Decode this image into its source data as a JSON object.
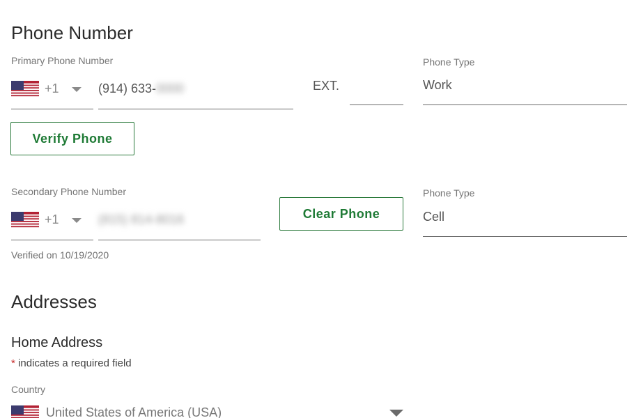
{
  "phone_section": {
    "title": "Phone Number",
    "primary": {
      "label": "Primary Phone Number",
      "country_code": "+1",
      "number_visible": "(914) 633-",
      "number_hidden": "0000",
      "ext_label": "EXT.",
      "ext_value": "",
      "type_label": "Phone Type",
      "type_value": "Work",
      "verify_button": "Verify Phone"
    },
    "secondary": {
      "label": "Secondary Phone Number",
      "country_code": "+1",
      "number_hidden": "(815) 814-8016",
      "clear_button": "Clear Phone",
      "type_label": "Phone Type",
      "type_value": "Cell",
      "verified_text": "Verified on 10/19/2020"
    }
  },
  "address_section": {
    "title": "Addresses",
    "home_title": "Home Address",
    "required_star": "*",
    "required_note": "indicates a required field",
    "country_label": "Country",
    "country_value": "United States of America (USA)"
  },
  "colors": {
    "accent_green": "#1e7a35",
    "required_red": "#c62828"
  },
  "icons": [
    "us-flag-icon",
    "chevron-down-icon"
  ]
}
